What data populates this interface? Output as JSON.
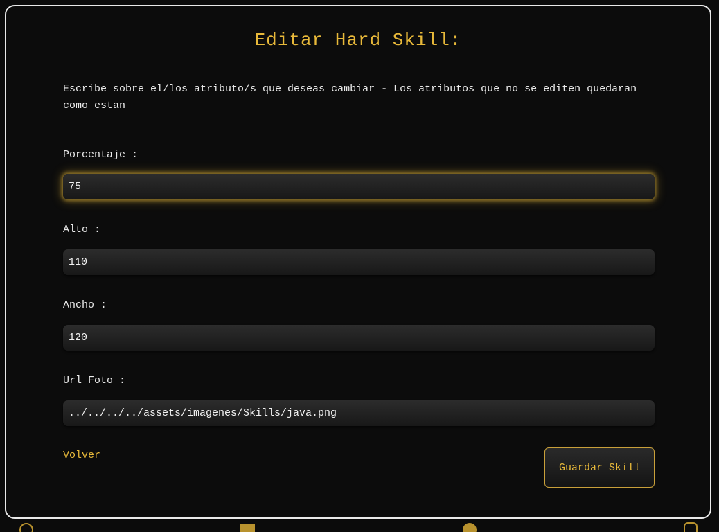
{
  "form": {
    "title": "Editar Hard Skill:",
    "description": "Escribe sobre el/los atributo/s que deseas cambiar - Los atributos que no se editen quedaran como estan",
    "fields": [
      {
        "label": "Porcentaje :",
        "value": "75"
      },
      {
        "label": "Alto :",
        "value": "110"
      },
      {
        "label": "Ancho :",
        "value": "120"
      },
      {
        "label": "Url Foto :",
        "value": "../../../../assets/imagenes/Skills/java.png"
      }
    ],
    "back_label": "Volver",
    "submit_label": "Guardar Skill"
  },
  "colors": {
    "accent": "#e8b93a",
    "background": "#0c0c0c",
    "border": "#e9e9e9"
  },
  "icons": [
    "circle-icon",
    "square-icon",
    "dot-icon",
    "rounded-square-icon"
  ]
}
